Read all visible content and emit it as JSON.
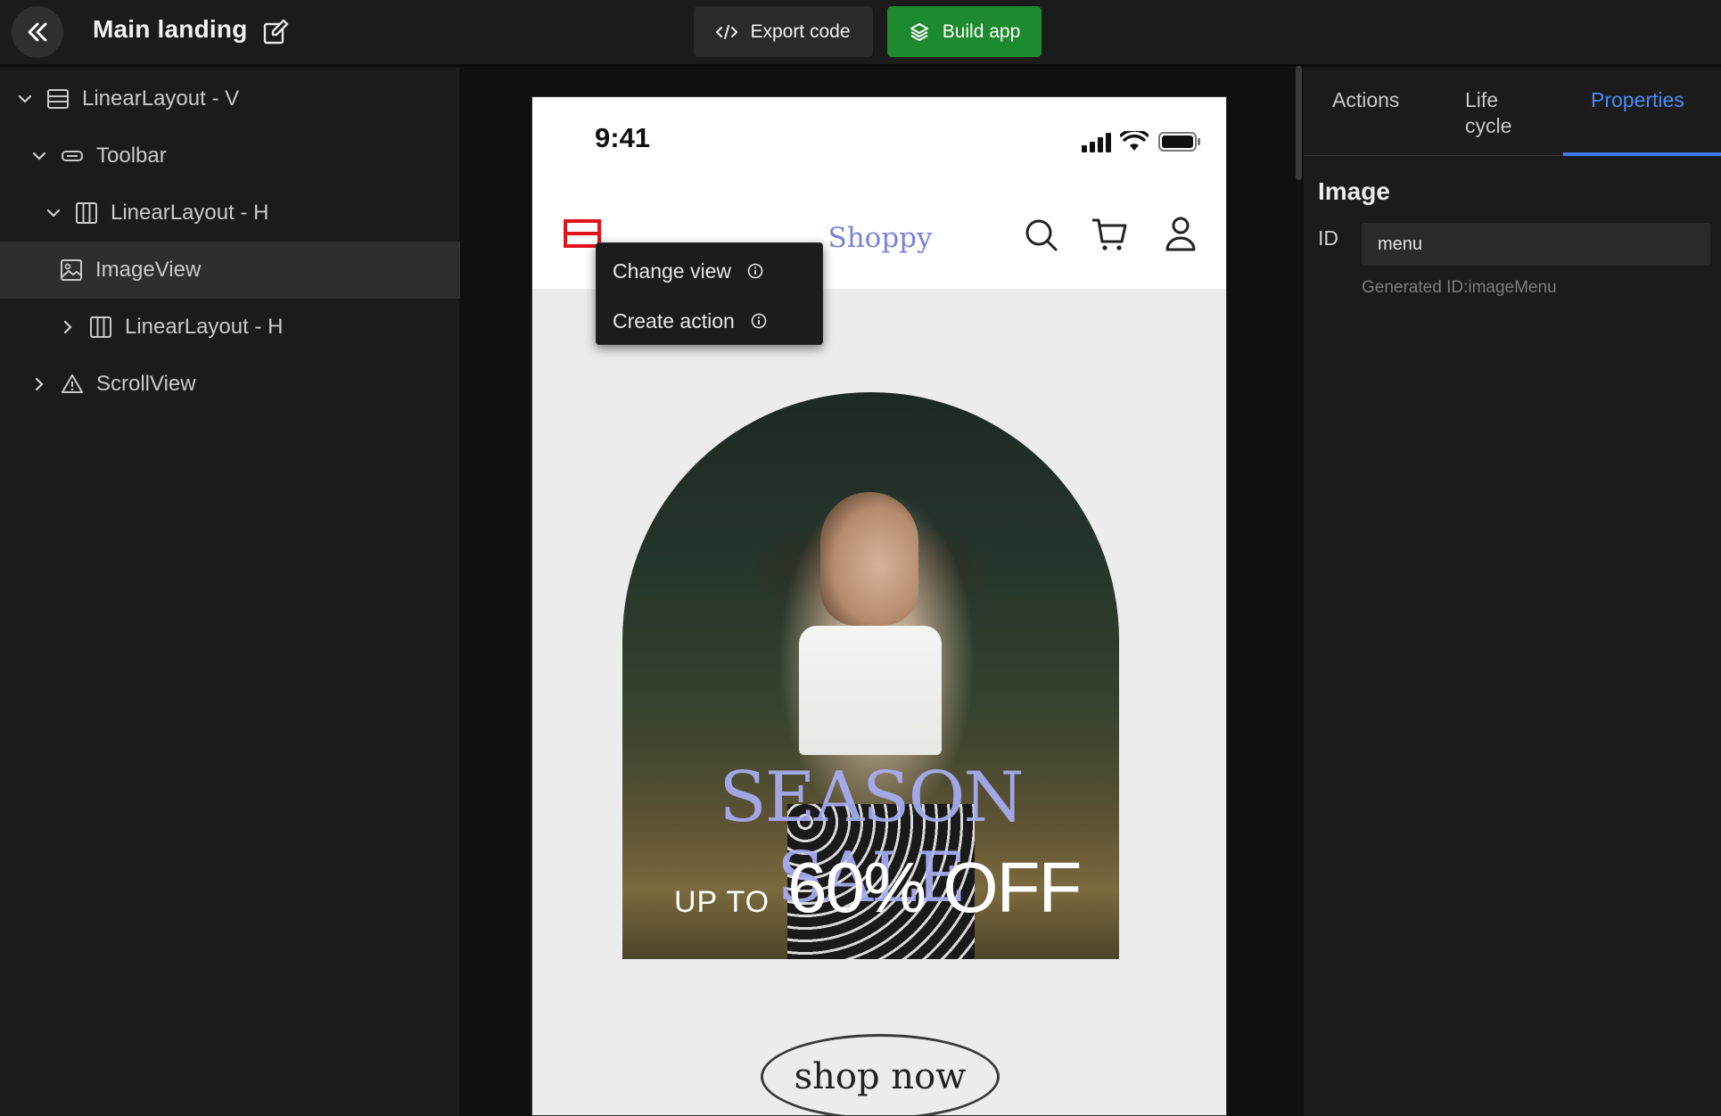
{
  "topbar": {
    "title": "Main landing",
    "export_label": "Export code",
    "build_label": "Build app"
  },
  "tree": [
    {
      "label": "LinearLayout - V",
      "expanded": true,
      "icon": "rows-icon"
    },
    {
      "label": "Toolbar",
      "expanded": true,
      "icon": "toolbar-icon"
    },
    {
      "label": "LinearLayout - H",
      "expanded": true,
      "icon": "columns-icon"
    },
    {
      "label": "ImageView",
      "selected": true,
      "icon": "image-icon"
    },
    {
      "label": "LinearLayout - H",
      "expanded": false,
      "icon": "columns-icon"
    },
    {
      "label": "ScrollView",
      "expanded": false,
      "icon": "warning-icon"
    }
  ],
  "phone": {
    "time": "9:41",
    "brand": "Shoppy",
    "banner": {
      "headline": "SEASON SALE",
      "upto": "UP TO",
      "discount": "60% OFF"
    },
    "shop_button": "shop now"
  },
  "popup": {
    "items": [
      "Change view",
      "Create action"
    ]
  },
  "right_panel": {
    "tabs": [
      "Actions",
      "Life\ncycle",
      "Properties"
    ],
    "active_tab": "Properties",
    "section_title": "Image",
    "id_label": "ID",
    "id_value": "menu",
    "generated_id": "Generated ID:imageMenu"
  },
  "colors": {
    "accent_blue": "#3e7be8",
    "build_green": "#1e8a2e",
    "brand_purple": "#7a83d8",
    "selection_red": "#e0141a"
  }
}
